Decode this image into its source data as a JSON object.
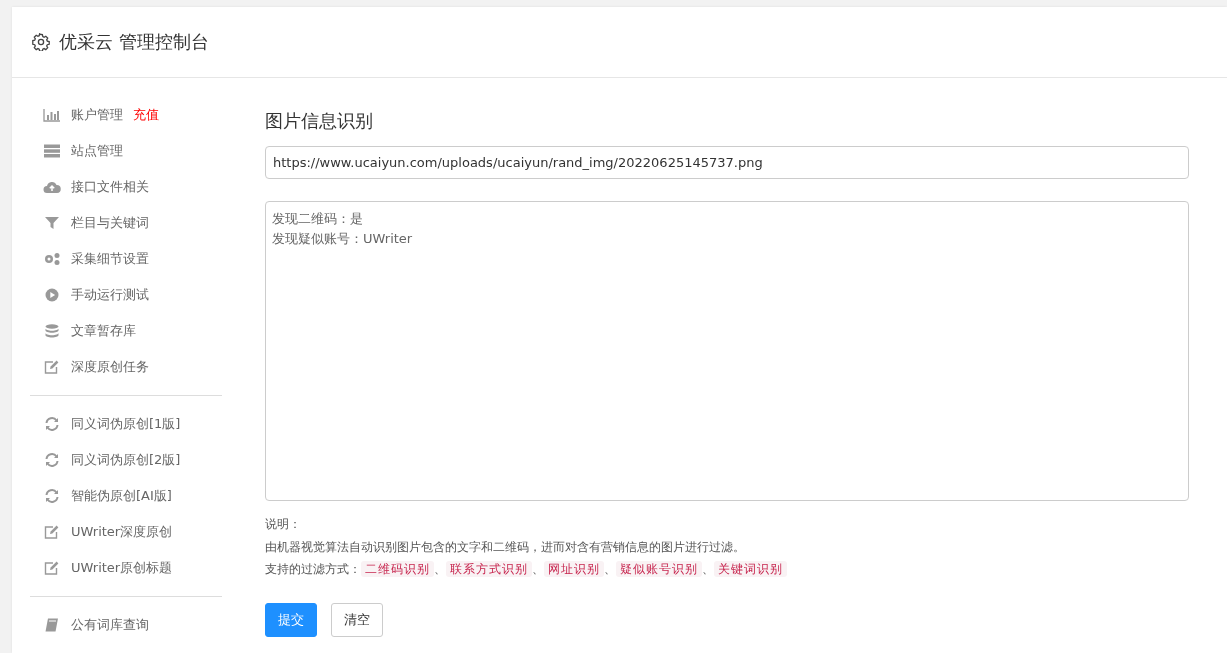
{
  "header": {
    "title": "优采云 管理控制台"
  },
  "sidebar": {
    "groups": [
      {
        "items": [
          {
            "kind": "chart",
            "label": "账户管理",
            "badge": "充值"
          },
          {
            "kind": "server",
            "label": "站点管理"
          },
          {
            "kind": "cloud",
            "label": "接口文件相关"
          },
          {
            "kind": "filter",
            "label": "栏目与关键词"
          },
          {
            "kind": "gears",
            "label": "采集细节设置"
          },
          {
            "kind": "play",
            "label": "手动运行测试"
          },
          {
            "kind": "database",
            "label": "文章暂存库"
          },
          {
            "kind": "edit",
            "label": "深度原创任务"
          }
        ]
      },
      {
        "items": [
          {
            "kind": "refresh",
            "label": "同义词伪原创[1版]"
          },
          {
            "kind": "refresh",
            "label": "同义词伪原创[2版]"
          },
          {
            "kind": "refresh",
            "label": "智能伪原创[AI版]"
          },
          {
            "kind": "edit",
            "label": "UWriter深度原创"
          },
          {
            "kind": "edit",
            "label": "UWriter原创标题"
          }
        ]
      },
      {
        "items": [
          {
            "kind": "book",
            "label": "公有词库查询"
          }
        ]
      }
    ]
  },
  "main": {
    "title": "图片信息识别",
    "url_field": {
      "value": "https://www.ucaiyun.com/uploads/ucaiyun/rand_img/20220625145737.png"
    },
    "result_box": {
      "lines": [
        "发现二维码：是",
        "发现疑似账号：UWriter"
      ]
    },
    "notes": {
      "heading": "说明：",
      "description": "由机器视觉算法自动识别图片包含的文字和二维码，进而对含有营销信息的图片进行过滤。",
      "methods_label": "支持的过滤方式：",
      "separator": "、",
      "methods": [
        "二维码识别",
        "联系方式识别",
        "网址识别",
        "疑似账号识别",
        "关键词识别"
      ]
    },
    "buttons": [
      {
        "label": "提交",
        "kind": "primary"
      },
      {
        "label": "清空",
        "kind": "default"
      }
    ]
  }
}
